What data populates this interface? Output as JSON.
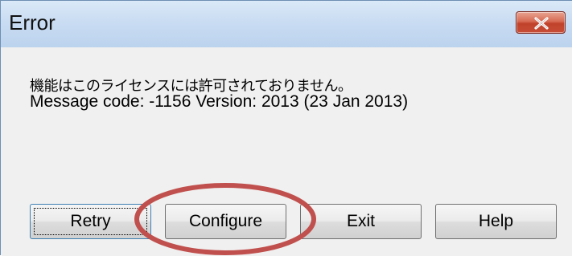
{
  "window": {
    "title": "Error"
  },
  "message": {
    "line1": "機能はこのライセンスには許可されておりません。",
    "line2": "Message code: -1156  Version: 2013 (23 Jan 2013)"
  },
  "buttons": {
    "retry": "Retry",
    "configure": "Configure",
    "exit": "Exit",
    "help": "Help"
  },
  "icons": {
    "close": "close-icon"
  },
  "colors": {
    "titlebar": "#c9dcf2",
    "close_button": "#c84e36",
    "highlight_ellipse": "#c0504d",
    "dialog_background": "#f0f0f0"
  }
}
